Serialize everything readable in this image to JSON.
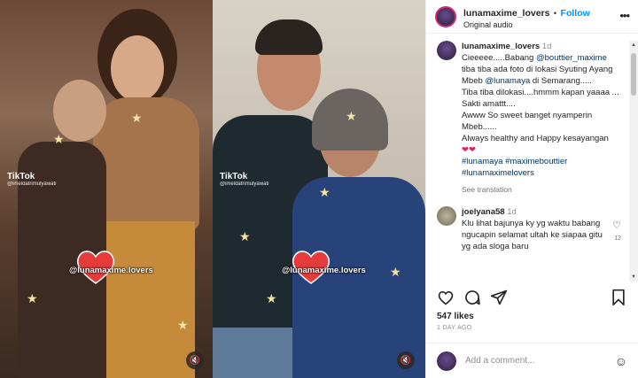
{
  "media": {
    "tiktok_label": "TikTok",
    "tiktok_handle": "@imeldatrimulyawati",
    "watermark": "@lunamaxime.lovers",
    "heart_color": "#e53b3b"
  },
  "header": {
    "username": "lunamaxime_lovers",
    "dot": "•",
    "follow_label": "Follow",
    "subtitle": "Original audio",
    "more_icon": "more-horizontal-icon"
  },
  "caption": {
    "username": "lunamaxime_lovers",
    "time": "1d",
    "line1_pre": "Cieeeee.....Babang ",
    "mention1": "@bouttier_maxime",
    "line2": " tiba tiba ada foto di lokasi Syuting Ayang Mbeb ",
    "mention2": "@lunamaya",
    "line3": " di Semarang.....",
    "line4": "Tiba tiba dilokasi....hmmm kapan yaaaa ...",
    "line5": "Sakti amattt....",
    "line6": "Awww So sweet banget nyamperin Mbeb......",
    "line7": "Always healthy and Happy kesayangan",
    "hearts": "❤❤",
    "hashtags1": "#lunamaya #maximebouttier",
    "hashtags2": "#lunamaximelovers",
    "see_translation": "See translation"
  },
  "reply": {
    "username": "joelyana58",
    "time": "1d",
    "text": "Klu lihat bajunya ky yg waktu babang ngucapin selamat ultah ke siapaa gitu yg ada sloga baru",
    "like_count": "12"
  },
  "footer": {
    "likes": "547 likes",
    "ago": "1 DAY AGO",
    "add_comment_placeholder": "Add a comment..."
  },
  "icons": [
    "heart-icon",
    "comment-icon",
    "share-icon",
    "bookmark-icon",
    "emoji-icon",
    "mute-icon"
  ]
}
